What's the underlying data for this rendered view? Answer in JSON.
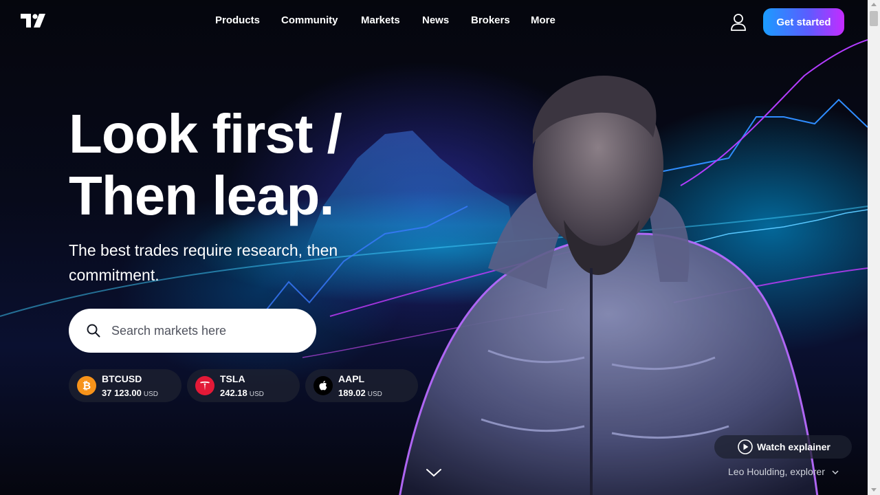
{
  "brand": {
    "logo_icon": "tradingview-logo-icon"
  },
  "nav": {
    "items": [
      {
        "label": "Products"
      },
      {
        "label": "Community"
      },
      {
        "label": "Markets"
      },
      {
        "label": "News"
      },
      {
        "label": "Brokers"
      },
      {
        "label": "More"
      }
    ],
    "user_icon": "user-icon",
    "cta_label": "Get started"
  },
  "hero": {
    "headline_line1": "Look first /",
    "headline_line2": "Then leap.",
    "subtitle": "The best trades require research, then commitment.",
    "search_placeholder": "Search markets here"
  },
  "tickers": [
    {
      "symbol": "BTCUSD",
      "price": "37 123.00",
      "currency": "USD",
      "icon": "bitcoin-icon",
      "color": "#f7931a"
    },
    {
      "symbol": "TSLA",
      "price": "242.18",
      "currency": "USD",
      "icon": "tesla-icon",
      "color": "#e31937"
    },
    {
      "symbol": "AAPL",
      "price": "189.02",
      "currency": "USD",
      "icon": "apple-icon",
      "color": "#000000"
    }
  ],
  "explainer": {
    "label": "Watch explainer",
    "icon": "play-icon"
  },
  "credit": {
    "label": "Leo Houlding, explorer",
    "icon": "chevron-down-icon"
  },
  "colors": {
    "cta_start": "#1b9cff",
    "cta_end": "#c52bff",
    "background": "#05060d"
  }
}
